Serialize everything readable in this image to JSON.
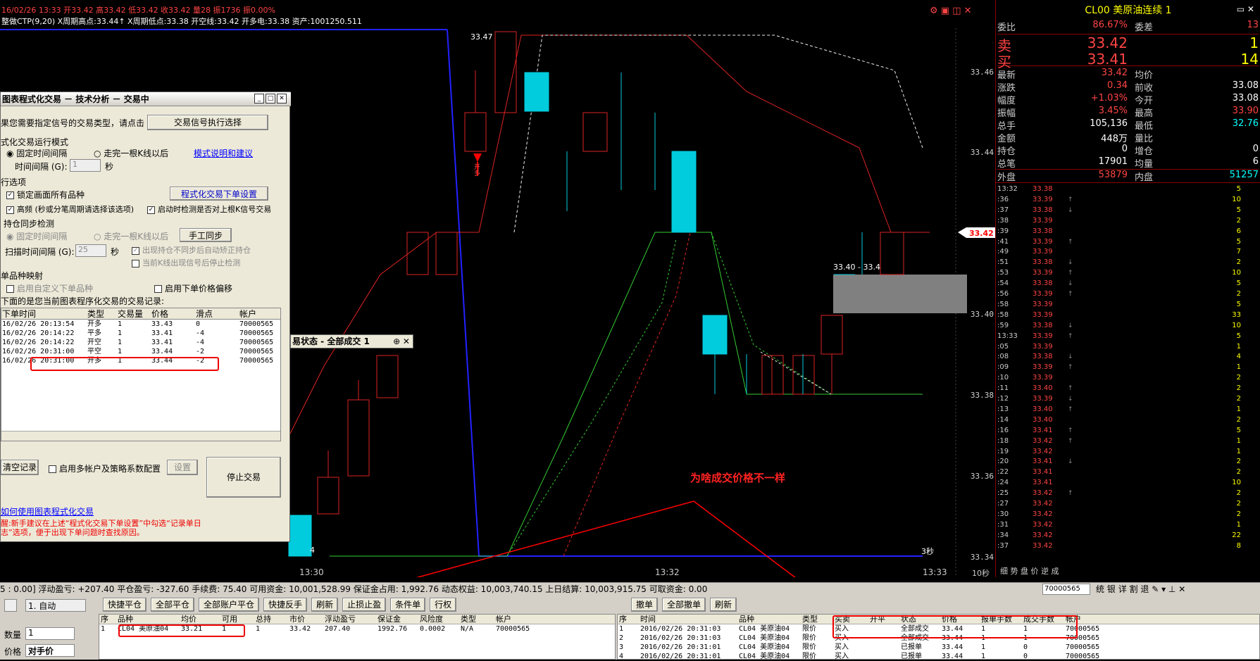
{
  "topbar": {
    "line1": "16/02/26 13:33 开33.42 高33.42 低33.42 收33.42 量28 振1736 振0.00%",
    "line2": "整做CTP(9,20) X周期高点:33.44↑ X周期低点:33.38 开空线:33.42 开多电:33.38 资产:1001250.511"
  },
  "chart": {
    "price_ticks": [
      "33.46",
      "33.44",
      "33.42",
      "33.40",
      "33.38",
      "33.36",
      "33.34"
    ],
    "current_price_tag": "33.42",
    "time_ticks": [
      "13:30",
      "13:32",
      "13:33"
    ],
    "period_label": "10秒",
    "countdown": "3秒",
    "high_label": "33.47",
    "range_label": "33.40 - 33.4",
    "left_low_label": "4",
    "annotation": "为啥成交价格不一样",
    "signal_label": "开多"
  },
  "quote": {
    "title": "CL00 美原油连续 1",
    "rows": [
      {
        "l": "委比",
        "v": "86.67%",
        "vc": "#f44",
        "l2": "委差",
        "v2": "13",
        "v2c": "#f44"
      },
      {
        "l": "最新",
        "v": "33.42",
        "vc": "#f44",
        "l2": "均价",
        "v2": "",
        "v2c": "#fff"
      },
      {
        "l": "涨跌",
        "v": "0.34",
        "vc": "#f44",
        "l2": "前收",
        "v2": "33.08",
        "v2c": "#fff"
      },
      {
        "l": "幅度",
        "v": "+1.03%",
        "vc": "#f44",
        "l2": "今开",
        "v2": "33.08",
        "v2c": "#fff"
      },
      {
        "l": "振幅",
        "v": "3.45%",
        "vc": "#f44",
        "l2": "最高",
        "v2": "33.90",
        "v2c": "#f44"
      },
      {
        "l": "总手",
        "v": "105,136",
        "vc": "#fff",
        "l2": "最低",
        "v2": "32.76",
        "v2c": "#0ff"
      },
      {
        "l": "金额",
        "v": "448万",
        "vc": "#fff",
        "l2": "量比",
        "v2": "",
        "v2c": "#fff"
      },
      {
        "l": "持仓",
        "v": "0",
        "vc": "#fff",
        "l2": "增仓",
        "v2": "0",
        "v2c": "#fff"
      },
      {
        "l": "总笔",
        "v": "17901",
        "vc": "#fff",
        "l2": "均量",
        "v2": "6",
        "v2c": "#fff"
      },
      {
        "l": "外盘",
        "v": "53879",
        "vc": "#f44",
        "l2": "内盘",
        "v2": "51257",
        "v2c": "#0ff"
      }
    ],
    "sell_label": "卖",
    "sell_price": "33.42",
    "sell_qty": "1",
    "buy_label": "买",
    "buy_price": "33.41",
    "buy_qty": "14",
    "bottom_tabs": "细 势 盘 价 逆 成"
  },
  "ticks": [
    {
      "t": "13:32",
      "p": "33.38",
      "a": "",
      "q": "5"
    },
    {
      "t": ":36",
      "p": "33.39",
      "a": "↑",
      "q": "10"
    },
    {
      "t": ":37",
      "p": "33.38",
      "a": "↓",
      "q": "5"
    },
    {
      "t": ":38",
      "p": "33.39",
      "a": "",
      "q": "2"
    },
    {
      "t": ":39",
      "p": "33.38",
      "a": "",
      "q": "6"
    },
    {
      "t": ":41",
      "p": "33.39",
      "a": "↑",
      "q": "5"
    },
    {
      "t": ":49",
      "p": "33.39",
      "a": "",
      "q": "7"
    },
    {
      "t": ":51",
      "p": "33.38",
      "a": "↓",
      "q": "2"
    },
    {
      "t": ":53",
      "p": "33.39",
      "a": "↑",
      "q": "10"
    },
    {
      "t": ":54",
      "p": "33.38",
      "a": "↓",
      "q": "5"
    },
    {
      "t": ":56",
      "p": "33.39",
      "a": "↑",
      "q": "2"
    },
    {
      "t": ":58",
      "p": "33.39",
      "a": "",
      "q": "5"
    },
    {
      "t": ":58",
      "p": "33.39",
      "a": "",
      "q": "33"
    },
    {
      "t": ":59",
      "p": "33.38",
      "a": "↓",
      "q": "10"
    },
    {
      "t": "13:33",
      "p": "33.39",
      "a": "↑",
      "q": "5"
    },
    {
      "t": ":05",
      "p": "33.39",
      "a": "",
      "q": "1"
    },
    {
      "t": ":08",
      "p": "33.38",
      "a": "↓",
      "q": "4"
    },
    {
      "t": ":09",
      "p": "33.39",
      "a": "↑",
      "q": "1"
    },
    {
      "t": ":10",
      "p": "33.39",
      "a": "",
      "q": "2"
    },
    {
      "t": ":11",
      "p": "33.40",
      "a": "↑",
      "q": "2"
    },
    {
      "t": ":12",
      "p": "33.39",
      "a": "↓",
      "q": "2"
    },
    {
      "t": ":13",
      "p": "33.40",
      "a": "↑",
      "q": "1"
    },
    {
      "t": ":14",
      "p": "33.40",
      "a": "",
      "q": "2"
    },
    {
      "t": ":16",
      "p": "33.41",
      "a": "↑",
      "q": "5"
    },
    {
      "t": ":18",
      "p": "33.42",
      "a": "↑",
      "q": "1"
    },
    {
      "t": ":19",
      "p": "33.42",
      "a": "",
      "q": "1"
    },
    {
      "t": ":20",
      "p": "33.41",
      "a": "↓",
      "q": "2"
    },
    {
      "t": ":22",
      "p": "33.41",
      "a": "",
      "q": "2"
    },
    {
      "t": ":24",
      "p": "33.41",
      "a": "",
      "q": "10"
    },
    {
      "t": ":25",
      "p": "33.42",
      "a": "↑",
      "q": "2"
    },
    {
      "t": ":27",
      "p": "33.42",
      "a": "",
      "q": "2"
    },
    {
      "t": ":30",
      "p": "33.42",
      "a": "",
      "q": "2"
    },
    {
      "t": ":31",
      "p": "33.42",
      "a": "",
      "q": "1"
    },
    {
      "t": ":34",
      "p": "33.42",
      "a": "",
      "q": "22"
    },
    {
      "t": ":37",
      "p": "33.42",
      "a": "",
      "q": "8"
    }
  ],
  "dialog": {
    "title": "图表程式化交易 － 技术分析 － 交易中",
    "prompt": "果您需要指定信号的交易类型，请点击",
    "btn_signal": "交易信号执行选择",
    "sec_mode": "式化交易运行模式",
    "opt_fixed": "固定时间间隔",
    "opt_bar": "走完一根K线以后",
    "link_mode": "模式说明和建议",
    "interval_label": "时间间隔 (G):",
    "interval_val": "1",
    "sec": "秒",
    "sec_options": "行选项",
    "opt_lock": "锁定画面所有品种",
    "btn_order_setting": "程式化交易下单设置",
    "opt_hf": "高频 (秒或分笔周期请选择该选项)",
    "opt_check": "启动时检测是否对上根K信号交易",
    "sec_sync": "持仓同步检测",
    "sync_fixed": "固定时间间隔",
    "sync_bar": "走完一根K线以后",
    "btn_manual_sync": "手工同步",
    "scan_label": "扫描时间间隔 (G):",
    "scan_val": "25",
    "opt_auto_fix": "出现持仓不同步后自动矫正持仓",
    "opt_stop_check": "当前K线出现信号后停止检测",
    "sec_map": "单品种映射",
    "opt_custom": "启用自定义下单品种",
    "opt_offset": "启用下单价格偏移",
    "records_label": "下面的是您当前图表程序化交易的交易记录:",
    "rec_headers": [
      "下单时间",
      "类型",
      "交易量",
      "价格",
      "滑点",
      "帐户"
    ],
    "records": [
      [
        "16/02/26 20:13:54",
        "开多",
        "1",
        "33.43",
        "0",
        "70000565"
      ],
      [
        "16/02/26 20:14:22",
        "平多",
        "1",
        "33.41",
        "-4",
        "70000565"
      ],
      [
        "16/02/26 20:14:22",
        "开空",
        "1",
        "33.41",
        "-4",
        "70000565"
      ],
      [
        "16/02/26 20:31:00",
        "平空",
        "1",
        "33.44",
        "-2",
        "70000565"
      ],
      [
        "16/02/26 20:31:00",
        "开多",
        "1",
        "33.44",
        "-2",
        "70000565"
      ]
    ],
    "btn_clear": "清空记录",
    "opt_multi": "启用多帐户及策略系数配置",
    "btn_setting": "设置",
    "btn_stop": "停止交易",
    "link_howto": "如何使用图表程式化交易",
    "tip": "醒:新手建议在上述“程式化交易下单设置”中勾选“记录单日志”选项，便于出现下单问题时查找原因。"
  },
  "status_window": {
    "title": "易状态 - 全部成交 1"
  },
  "account": {
    "text": "5 : 0.00]  浮动盈亏: +207.40  平仓盈亏: -327.60  手续费: 75.40  可用资金: 10,001,528.99  保证金占用: 1,992.76  动态权益: 10,003,740.15  上日结算: 10,003,915.75  可取资金: 0.00",
    "account_select": "70000565",
    "icon_buttons": [
      "统",
      "银",
      "详",
      "割",
      "退"
    ]
  },
  "left_bottom": {
    "mode": "1. 自动",
    "qty_label": "数量",
    "qty": "1",
    "price_label": "价格",
    "price": "对手价"
  },
  "positions": {
    "toolbar": [
      "快捷平仓",
      "全部平仓",
      "全部账户平仓",
      "快捷反手",
      "刷新",
      "止损止盈",
      "条件单",
      "行权"
    ],
    "headers": [
      "序",
      "品种",
      "均价",
      "可用",
      "总持",
      "市价",
      "浮动盈亏",
      "保证金",
      "风险度",
      "类型",
      "帐户"
    ],
    "rows": [
      [
        "1",
        "CL04 美原油04",
        "33.21",
        "1",
        "1",
        "33.42",
        "207.40",
        "1992.76",
        "0.0002",
        "N/A",
        "70000565"
      ]
    ]
  },
  "orders": {
    "toolbar": [
      "撤单",
      "全部撤单",
      "刷新"
    ],
    "headers": [
      "序",
      "时间",
      "品种",
      "类型",
      "买卖",
      "开平",
      "状态",
      "价格",
      "报单手数",
      "成交手数",
      "帐户"
    ],
    "rows": [
      [
        "1",
        "2016/02/26 20:31:03",
        "CL04 美原油04",
        "限价",
        "买入",
        "",
        "全部成交",
        "33.44",
        "1",
        "1",
        "70000565"
      ],
      [
        "2",
        "2016/02/26 20:31:03",
        "CL04 美原油04",
        "限价",
        "买入",
        "",
        "全部成交",
        "33.44",
        "1",
        "1",
        "70000565"
      ],
      [
        "3",
        "2016/02/26 20:31:01",
        "CL04 美原油04",
        "限价",
        "买入",
        "",
        "已报单",
        "33.44",
        "1",
        "0",
        "70000565"
      ],
      [
        "4",
        "2016/02/26 20:31:01",
        "CL04 美原油04",
        "限价",
        "买入",
        "",
        "已报单",
        "33.44",
        "1",
        "0",
        "70000565"
      ]
    ]
  }
}
